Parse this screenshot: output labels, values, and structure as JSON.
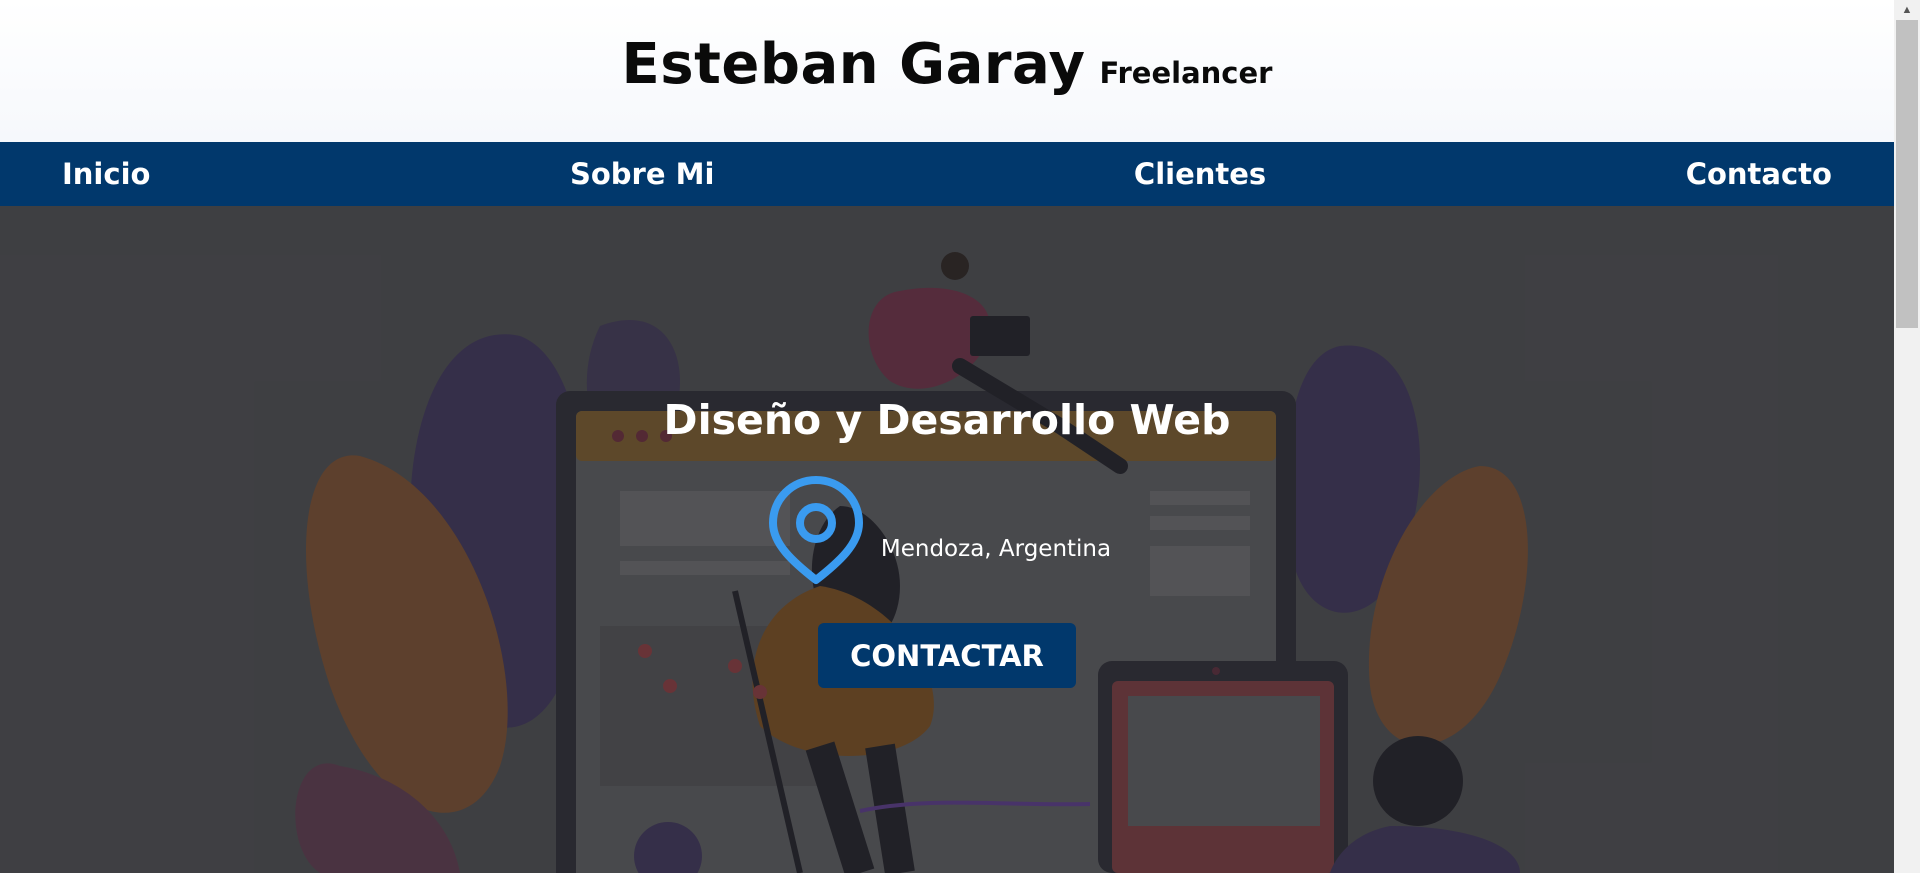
{
  "header": {
    "name": "Esteban Garay",
    "tagline": "Freelancer"
  },
  "nav": {
    "items": [
      {
        "label": "Inicio"
      },
      {
        "label": "Sobre Mi"
      },
      {
        "label": "Clientes"
      },
      {
        "label": "Contacto"
      }
    ]
  },
  "hero": {
    "title": "Diseño y Desarrollo Web",
    "location_icon": "map-pin-icon",
    "location": "Mendoza, Argentina",
    "button_label": "CONTACTAR"
  },
  "colors": {
    "nav_bg": "#01386c",
    "button_bg": "#01386c",
    "pin_icon": "#3a9bf0",
    "hero_bg": "#4b4c4f"
  }
}
